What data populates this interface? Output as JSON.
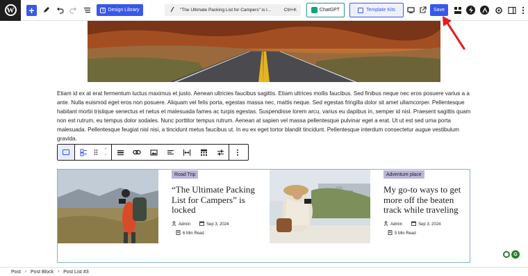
{
  "toolbar": {
    "design_library_label": "Design Library",
    "doc_title": "\"The Ultimate Packing List for Campers\" is l...",
    "shortcut": "Ctrl+K",
    "chatgpt_label": "ChatGPT",
    "template_kits_label": "Template Kits",
    "save_label": "Save"
  },
  "paragraph": {
    "segments": [
      "Etiam id ex at erat fermentum luctus maximus et justo. Aenean ultricies faucibus sagittis. Etiam ultrices mollis faucibus. Sed finibus neque nec eros posuere varius a a ante. Nulla euismod eget eros non posuere. Aliquam vel felis porta, egestas massa nec, mattis neque. Sed egestas fringilla dolor sit amet ullamcorper. Pellentesque habitant morbi tristique senectus et netus et malesuada fames ac turpis egestas. Suspendisse lorem arcu, varius eu dapibus in, semper id nisl. Praesent sagittis quam non est rutrum, eu tempus dolor sodales. Nunc porttitor tempus rutrum. Aenean at sapien vel massa pellentesque pulvinar eget a erat. Ut ut est sed urna porta malesuada. Pellentesque feugiat nisl nisi, a tincidunt metus faucibus ut. In eu ex eget tortor blandit tincidunt. Pellentesque interdum consectetur augue vestibulum gravida."
    ]
  },
  "posts": [
    {
      "tag": "Road Trip",
      "title": "“The Ultimate Packing List for Campers” is locked",
      "author": "Admin",
      "date": "Sep 3, 2024",
      "read_time": "6 Min Read"
    },
    {
      "tag": "Adventure place",
      "title": "My go-to ways to get more off the beaten track while traveling",
      "author": "Admin",
      "date": "Sep 3, 2024",
      "read_time": "5 Min Read"
    }
  ],
  "breadcrumb": [
    "Post",
    "Post Block",
    "Post List #3"
  ],
  "colors": {
    "accent": "#3858e9",
    "tag_bg": "#b9b6d8",
    "selection_border": "#7fb2d6"
  }
}
